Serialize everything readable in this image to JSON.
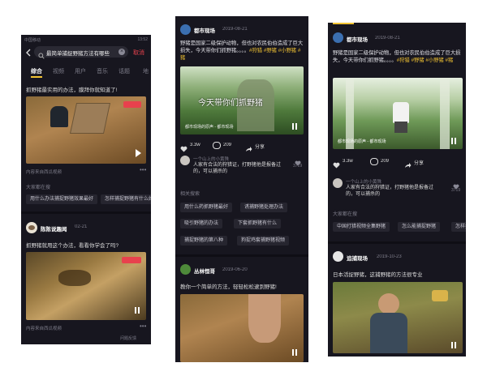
{
  "colors": {
    "accent": "#f3c433",
    "bg": "#17161f",
    "search_red": "#e8414d"
  },
  "p1": {
    "status": {
      "carrier": "中国移动",
      "time": "13:52"
    },
    "search": {
      "value": "最简单捕捉野猪方法有哪些",
      "cancel": "取消"
    },
    "tabs": [
      "综合",
      "视频",
      "用户",
      "音乐",
      "话题",
      "地"
    ],
    "item1": {
      "text": "抓野猪最实用的办法，膜拜你就知道了!",
      "source": "内容来自西瓜视频"
    },
    "related": {
      "title": "大家都在搜",
      "chips": [
        "用什么办法捕捉野猪效果最好",
        "怎样捕捉野猪有什么好"
      ]
    },
    "item2": {
      "author": "陈陈说趣闻",
      "date": "02-21",
      "text": "抓野猪就用这个办法，看看你学会了吗?",
      "source": "内容来自西瓜视频",
      "corner": "问题反馈"
    }
  },
  "p2": {
    "post1": {
      "author": "都市现场",
      "date": "2019-08-21",
      "text": "野猪是国家二级保护动物，但也对农民伯伯造成了巨大损失，今天带你们抓野猪。。。。",
      "tags": "#狩猎 #野猪 #小野猪 #猪",
      "caption": "今天带你们抓野猪",
      "overlay_text": "都市现场的原声 - 都市现场",
      "likes": "3.3w",
      "comments": "209",
      "share": "分享"
    },
    "comment": {
      "user": "一个山上的小黄殊",
      "text": "人家有合法的狩猎证，打野猪他是报备过的，可以捕杀的",
      "likes": "3719"
    },
    "related": {
      "title": "相关搜索",
      "chips": [
        "用什么药抓野猪最好",
        "诱捕野猪处理办法",
        "吸引野猪的办法",
        "下套抓野猪有什么",
        "捕捉野猪的第八种",
        "狗捉鸡套捕野猪视频"
      ]
    },
    "post2": {
      "author": "丛林恒哥",
      "date": "2019-06-20",
      "text": "教你一个简单的方法，轻轻松松逮到野猪!"
    }
  },
  "p3": {
    "post1": {
      "author": "都市现场",
      "date": "2019-08-21",
      "text": "野猪是国家二级保护动物，但也对农民伯伯造成了巨大损失，今天带你们抓野猪。。。。",
      "tags": "#狩猎 #野猪 #小野猪 #猪",
      "overlay_text": "都市现场的原声 - 都市现场",
      "likes": "3.3w",
      "comments": "209",
      "share": "分享"
    },
    "comment": {
      "user": "一个山上的小黄殊",
      "text": "人家有合法的狩猎证，打野猪他是报备过的，可以捕杀的",
      "likes": "3719"
    },
    "related": {
      "title": "大家都在搜",
      "chips": [
        "中国打猎视频全集野猪",
        "怎么能捕捉野猪",
        "怎样把"
      ]
    },
    "post2": {
      "author": "追捕现场",
      "date": "2019-10-23",
      "text": "日本活捉野猪，这捕野猪的方法很专业"
    }
  }
}
